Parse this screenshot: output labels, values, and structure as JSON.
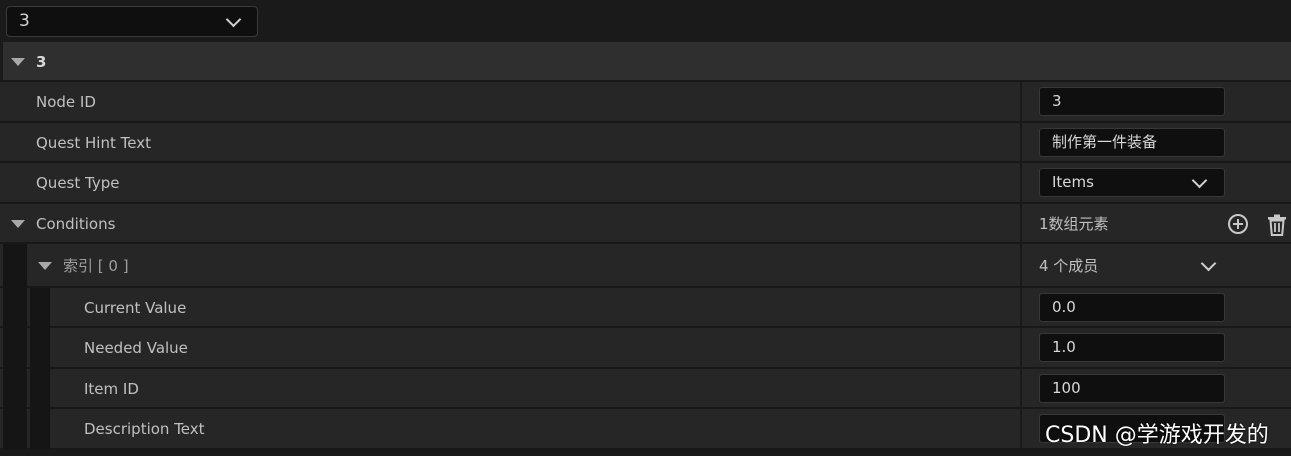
{
  "selector": {
    "value": "3"
  },
  "section": {
    "title": "3"
  },
  "rows": {
    "node_id": {
      "label": "Node ID",
      "value": "3"
    },
    "quest_hint_text": {
      "label": "Quest Hint Text",
      "value": "制作第一件装备"
    },
    "quest_type": {
      "label": "Quest Type",
      "value": "Items"
    },
    "conditions": {
      "label": "Conditions",
      "summary": "1数组元素"
    },
    "index0": {
      "label": "索引 [ 0 ]",
      "summary": "4 个成员"
    },
    "current_value": {
      "label": "Current Value",
      "value": "0.0"
    },
    "needed_value": {
      "label": "Needed Value",
      "value": "1.0"
    },
    "item_id": {
      "label": "Item ID",
      "value": "100"
    },
    "description_text": {
      "label": "Description Text",
      "value": ""
    }
  },
  "watermark": "CSDN @学游戏开发的",
  "icons": {
    "add": "plus-circle-icon",
    "delete": "trash-icon"
  }
}
